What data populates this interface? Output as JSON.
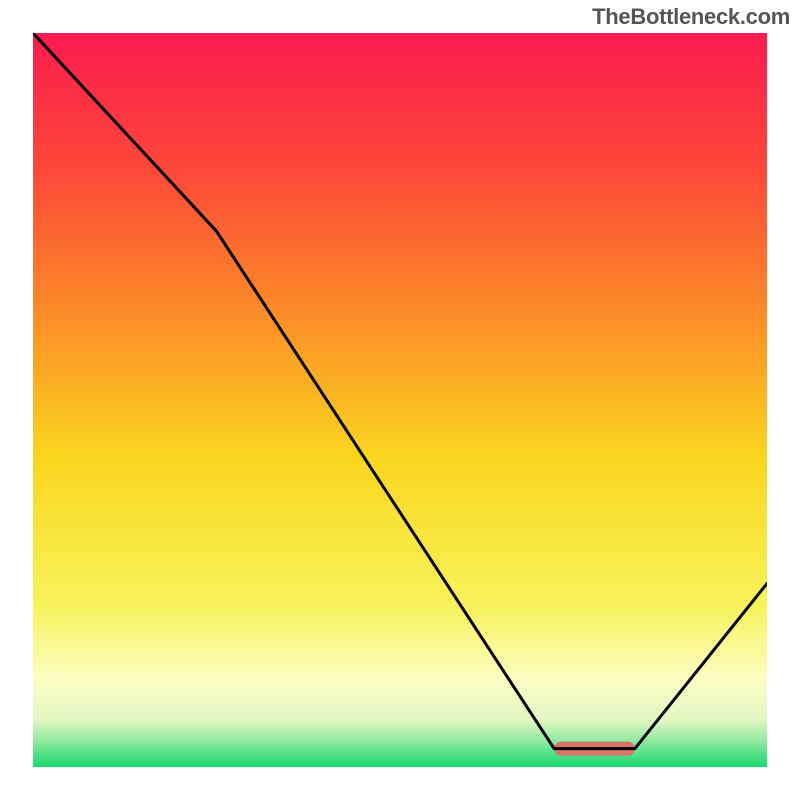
{
  "watermark": "TheBottleneck.com",
  "chart_data": {
    "type": "line",
    "title": "",
    "xlabel": "",
    "ylabel": "",
    "xlim": [
      0,
      100
    ],
    "ylim": [
      0,
      100
    ],
    "x": [
      0,
      25,
      71,
      74,
      82,
      100
    ],
    "values": [
      100,
      73,
      2.5,
      2.5,
      2.5,
      25
    ],
    "optimal_zone": {
      "x_start": 71,
      "x_end": 82,
      "y": 2.5
    },
    "gradient_stops": [
      {
        "offset": 0.0,
        "color": "#fc1b4f"
      },
      {
        "offset": 0.18,
        "color": "#fd4639"
      },
      {
        "offset": 0.38,
        "color": "#fc8b28"
      },
      {
        "offset": 0.58,
        "color": "#fad61e"
      },
      {
        "offset": 0.78,
        "color": "#f8f35a"
      },
      {
        "offset": 0.88,
        "color": "#fdfdc4"
      },
      {
        "offset": 0.935,
        "color": "#e4f7c3"
      },
      {
        "offset": 0.965,
        "color": "#8fe9a0"
      },
      {
        "offset": 1.0,
        "color": "#17d86a"
      }
    ]
  }
}
